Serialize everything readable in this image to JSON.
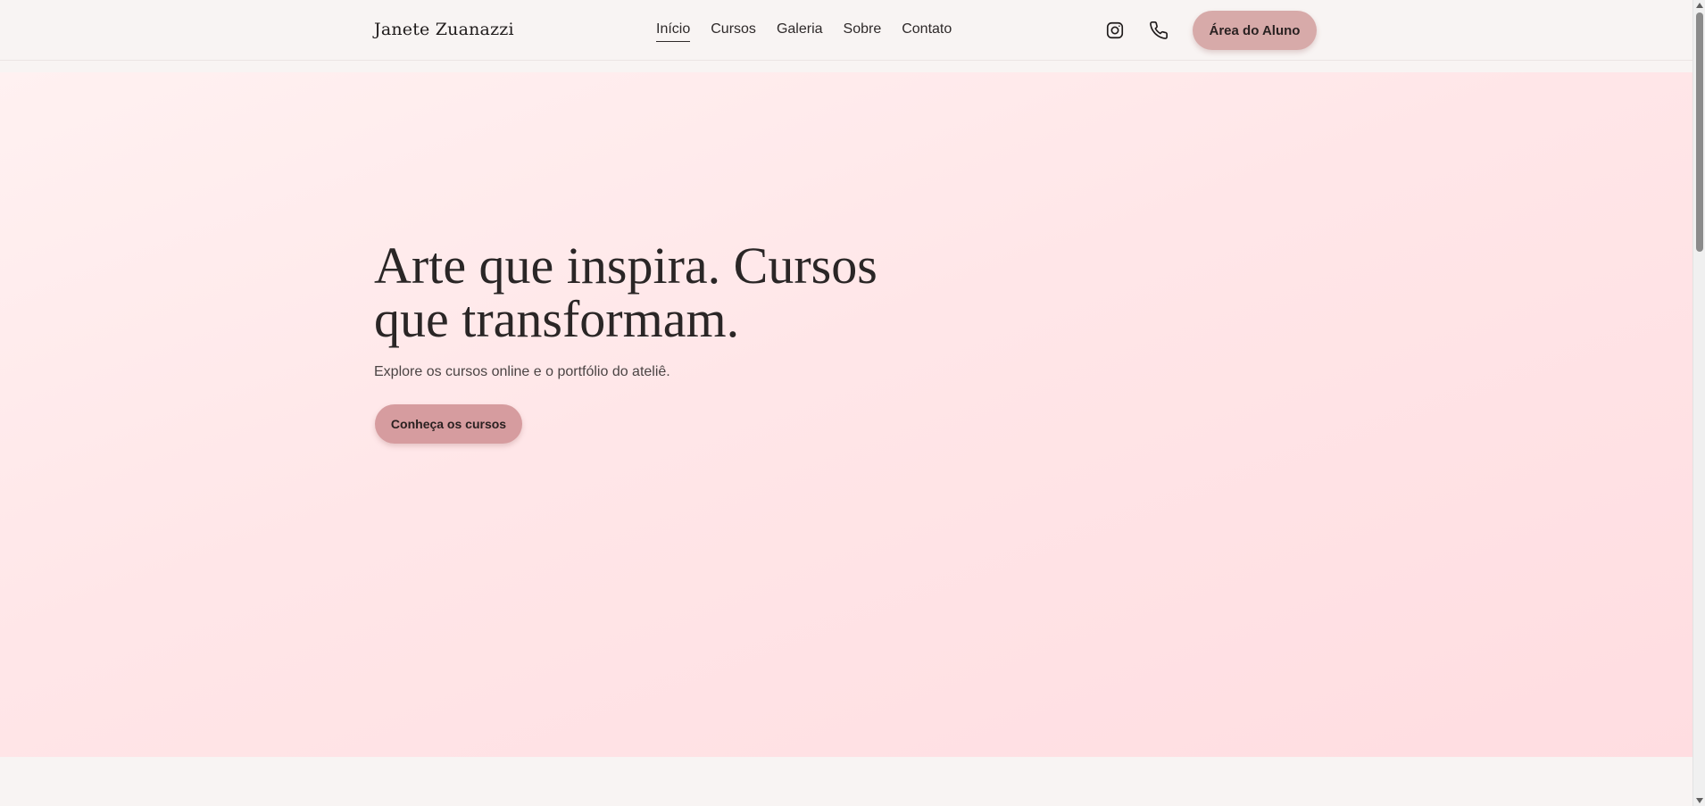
{
  "header": {
    "brand": "Janete Zuanazzi",
    "nav": [
      {
        "label": "Início",
        "active": true
      },
      {
        "label": "Cursos",
        "active": false
      },
      {
        "label": "Galeria",
        "active": false
      },
      {
        "label": "Sobre",
        "active": false
      },
      {
        "label": "Contato",
        "active": false
      }
    ],
    "icons": [
      "instagram-icon",
      "phone-icon"
    ],
    "student_area_label": "Área do Aluno"
  },
  "hero": {
    "title": "Arte que inspira. Cursos que transformam.",
    "subtitle": "Explore os cursos online e o portfólio do ateliê.",
    "cta_label": "Conheça os cursos"
  },
  "colors": {
    "accent": "#d7aaa9",
    "cta": "#d69c9f",
    "hero_bg": "#ffe6e8",
    "page_bg": "#f8f4f3"
  }
}
